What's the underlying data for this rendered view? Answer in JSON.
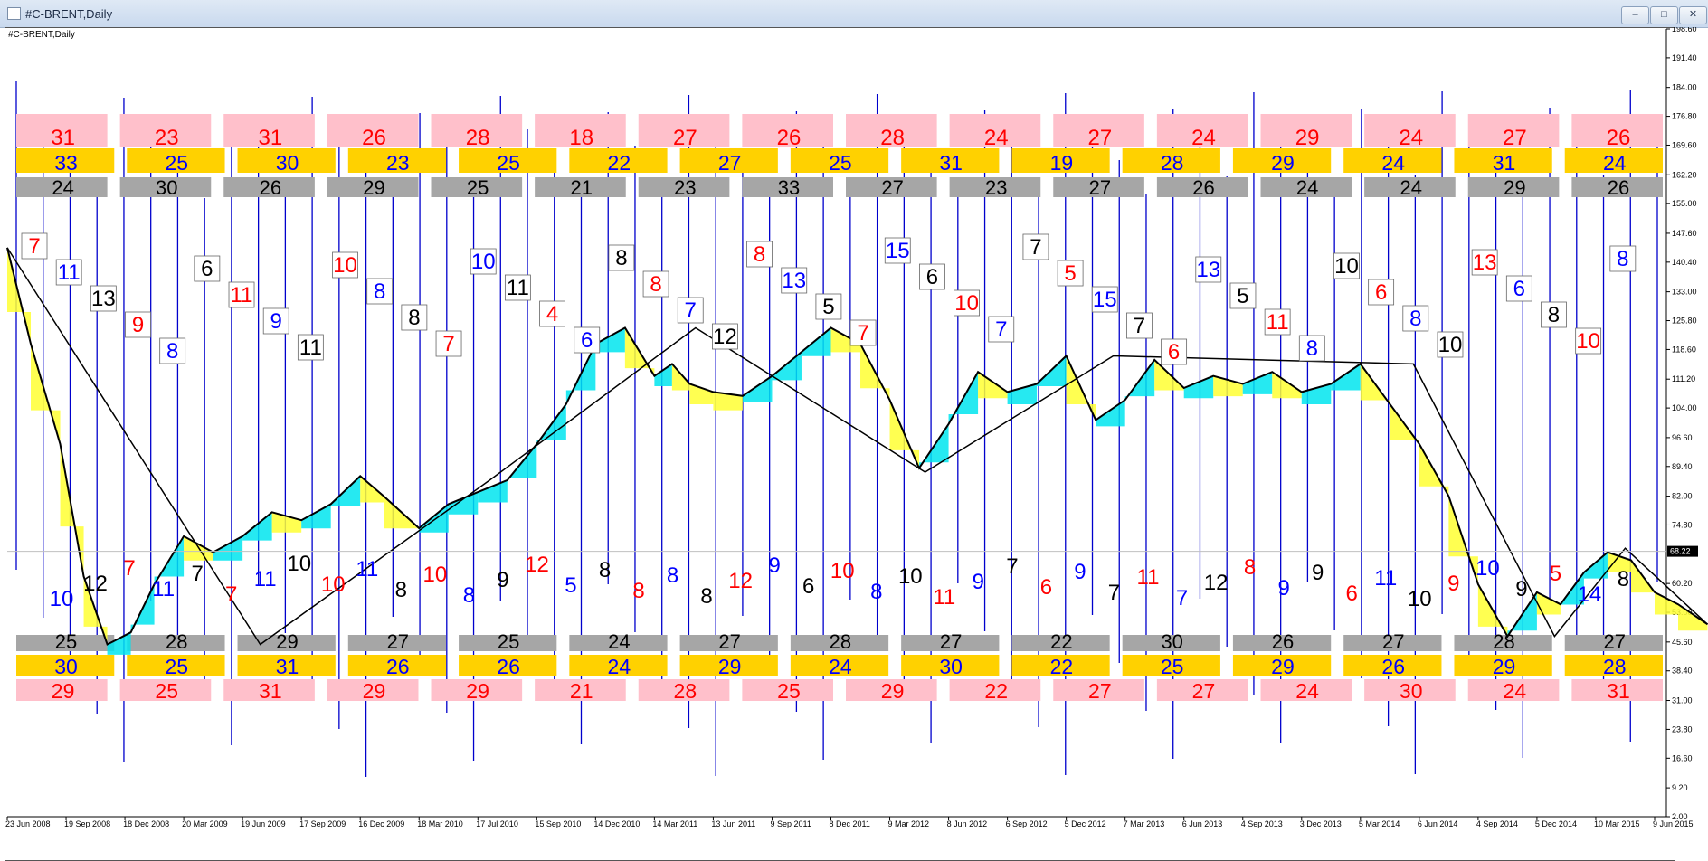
{
  "window": {
    "title": "#C-BRENT,Daily",
    "minimize_icon": "minimize-icon",
    "maximize_icon": "maximize-icon",
    "close_icon": "close-icon"
  },
  "chart_label": "#C-BRENT,Daily",
  "colors": {
    "price_line": "#000000",
    "cycle_line": "#0000cc",
    "band_pink": "#ffc0cb",
    "band_yellow": "#ffd100",
    "band_gray": "#a6a6a6",
    "fill_cyan": "#00e5ee",
    "fill_yellow": "#ffff33",
    "fill_green": "#33cc33",
    "red_text": "#ff0000",
    "blue_text": "#0000ff"
  },
  "chart_data": {
    "type": "line",
    "title": "#C-BRENT,Daily",
    "ylim": [
      23.8,
      198.6
    ],
    "y_ticks": [
      "198.60",
      "191.40",
      "184.00",
      "176.80",
      "169.60",
      "162.20",
      "155.00",
      "147.60",
      "140.40",
      "133.00",
      "125.80",
      "118.60",
      "111.20",
      "104.00",
      "96.60",
      "89.40",
      "82.00",
      "74.80",
      "60.20",
      "53.00",
      "45.60",
      "38.40",
      "31.00",
      "23.80",
      "16.60",
      "9.20",
      "2.00"
    ],
    "current_price": "68.22",
    "x_ticks": [
      "23 Jun 2008",
      "19 Sep 2008",
      "18 Dec 2008",
      "20 Mar 2009",
      "19 Jun 2009",
      "17 Sep 2009",
      "16 Dec 2009",
      "18 Mar 2010",
      "17 Jul 2010",
      "15 Sep 2010",
      "14 Dec 2010",
      "14 Mar 2011",
      "13 Jun 2011",
      "9 Sep 2011",
      "8 Dec 2011",
      "9 Mar 2012",
      "8 Jun 2012",
      "6 Sep 2012",
      "5 Dec 2012",
      "7 Mar 2013",
      "6 Jun 2013",
      "4 Sep 2013",
      "3 Dec 2013",
      "5 Mar 2014",
      "6 Jun 2014",
      "4 Sep 2014",
      "5 Dec 2014",
      "10 Mar 2015",
      "9 Jun 2015"
    ],
    "price_series": {
      "name": "#C-BRENT,Daily",
      "x_index": [
        0,
        0.4,
        0.9,
        1.3,
        1.7,
        2.1,
        2.5,
        3.0,
        3.5,
        4.0,
        4.5,
        5.0,
        5.5,
        6.0,
        6.4,
        7.0,
        7.5,
        8.0,
        8.5,
        9.0,
        9.5,
        10.0,
        10.5,
        11.0,
        11.3,
        11.6,
        12.0,
        12.5,
        13.0,
        13.5,
        14.0,
        14.5,
        15.0,
        15.5,
        16.0,
        16.5,
        17.0,
        17.5,
        18.0,
        18.5,
        19.0,
        19.5,
        20.0,
        20.5,
        21.0,
        21.5,
        22.0,
        22.5,
        23.0,
        23.5,
        24.0,
        24.5,
        25.0,
        25.5,
        26.0,
        26.4,
        26.8,
        27.2,
        27.6,
        28.0,
        28.4,
        28.9
      ],
      "values": [
        144,
        120,
        95,
        62,
        45,
        48,
        60,
        72,
        68,
        72,
        78,
        76,
        80,
        87,
        82,
        74,
        80,
        83,
        86,
        95,
        105,
        120,
        124,
        112,
        115,
        110,
        108,
        107,
        112,
        118,
        124,
        120,
        106,
        89,
        100,
        113,
        108,
        110,
        117,
        101,
        106,
        116,
        109,
        112,
        110,
        113,
        108,
        110,
        115,
        105,
        95,
        82,
        60,
        47,
        58,
        55,
        63,
        68,
        66,
        58,
        55,
        50
      ]
    },
    "top_pink_band": [
      "31",
      "23",
      "31",
      "26",
      "28",
      "18",
      "27",
      "26",
      "28",
      "24",
      "27",
      "24",
      "29",
      "24",
      "27",
      "26"
    ],
    "top_yellow_band": [
      "33",
      "25",
      "30",
      "23",
      "25",
      "22",
      "27",
      "25",
      "31",
      "19",
      "28",
      "29",
      "24",
      "31",
      "24"
    ],
    "top_gray_band": [
      "24",
      "30",
      "26",
      "29",
      "25",
      "21",
      "23",
      "33",
      "27",
      "23",
      "27",
      "26",
      "24",
      "24",
      "29",
      "26"
    ],
    "bottom_gray_band": [
      "25",
      "28",
      "29",
      "27",
      "25",
      "24",
      "27",
      "28",
      "27",
      "22",
      "30",
      "26",
      "27",
      "28",
      "27"
    ],
    "bottom_yellow_band": [
      "30",
      "25",
      "31",
      "26",
      "26",
      "24",
      "29",
      "24",
      "30",
      "22",
      "25",
      "29",
      "26",
      "29",
      "28"
    ],
    "bottom_pink_band": [
      "29",
      "25",
      "31",
      "29",
      "29",
      "21",
      "28",
      "25",
      "29",
      "22",
      "27",
      "27",
      "24",
      "30",
      "24",
      "31"
    ],
    "upper_counts": [
      "7",
      "11",
      "13",
      "9",
      "8",
      "6",
      "11",
      "9",
      "11",
      "10",
      "8",
      "8",
      "7",
      "10",
      "11",
      "4",
      "6",
      "8",
      "8",
      "7",
      "12",
      "8",
      "13",
      "5",
      "7",
      "15",
      "6",
      "10",
      "7",
      "7",
      "5",
      "15",
      "7",
      "6",
      "13",
      "5",
      "11",
      "8",
      "10",
      "6",
      "8",
      "10",
      "13",
      "6",
      "8",
      "10",
      "8"
    ],
    "lower_counts": [
      "10",
      "12",
      "7",
      "11",
      "7",
      "7",
      "11",
      "10",
      "10",
      "11",
      "8",
      "10",
      "8",
      "9",
      "12",
      "5",
      "8",
      "8",
      "8",
      "8",
      "12",
      "9",
      "6",
      "10",
      "8",
      "10",
      "11",
      "9",
      "7",
      "6",
      "9",
      "7",
      "11",
      "7",
      "12",
      "8",
      "9",
      "9",
      "6",
      "11",
      "10",
      "9",
      "10",
      "9",
      "5",
      "14",
      "8"
    ]
  }
}
